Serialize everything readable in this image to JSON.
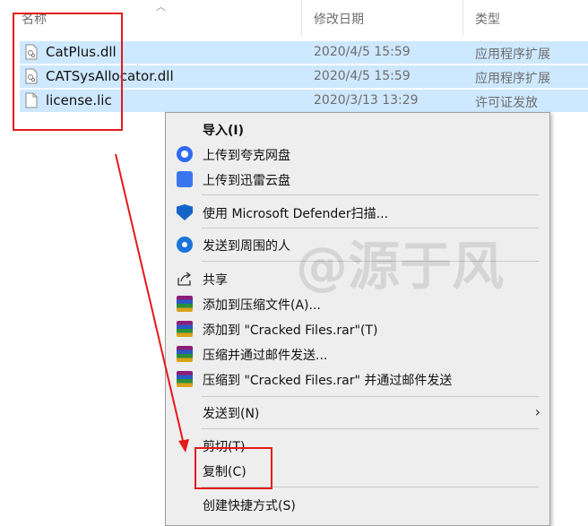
{
  "columns": {
    "name": "名称",
    "modified": "修改日期",
    "type": "类型"
  },
  "files": [
    {
      "name": "CatPlus.dll",
      "date": "2020/4/5 15:59",
      "type": "应用程序扩展",
      "icon": "dll-file-icon"
    },
    {
      "name": "CATSysAllocator.dll",
      "date": "2020/4/5 15:59",
      "type": "应用程序扩展",
      "icon": "dll-file-icon"
    },
    {
      "name": "license.lic",
      "date": "2020/3/13 13:29",
      "type": "许可证发放",
      "icon": "blank-file-icon"
    }
  ],
  "menu": {
    "import": "导入(I)",
    "upload_quark": "上传到夸克网盘",
    "upload_xunlei": "上传到迅雷云盘",
    "defender_scan": "使用 Microsoft Defender扫描...",
    "send_nearby": "发送到周围的人",
    "share": "共享",
    "add_archive": "添加到压缩文件(A)...",
    "add_rar": "添加到 \"Cracked Files.rar\"(T)",
    "compress_email": "压缩并通过邮件发送...",
    "compress_rar_email": "压缩到 \"Cracked Files.rar\" 并通过邮件发送",
    "send_to": "发送到(N)",
    "cut": "剪切(T)",
    "copy": "复制(C)",
    "create_shortcut": "创建快捷方式(S)"
  },
  "watermark": "@源于风",
  "colors": {
    "selection": "#cde8ff",
    "menu_bg": "#eeeeee",
    "annotation_red": "#e41a1a"
  }
}
